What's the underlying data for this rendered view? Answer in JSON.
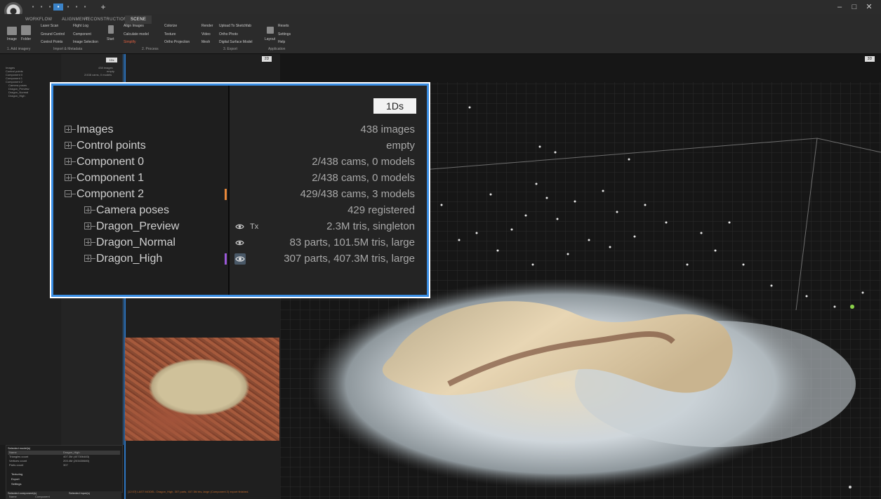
{
  "ribbon": {
    "tabs": [
      "WORKFLOW",
      "ALIGNMENT",
      "RECONSTRUCTION",
      "SCENE"
    ],
    "active_tab": "SCENE",
    "buttons": {
      "image": "Image",
      "folder": "Folder",
      "laser_scan": "Laser Scan",
      "ground_control": "Ground Control",
      "control_points": "Control Points",
      "flight_log": "Flight Log",
      "component": "Component",
      "image_selection": "Image Selection",
      "start": "Start",
      "align_images": "Align Images",
      "calculate_model": "Calculate model",
      "simplify": "Simplify",
      "colorize": "Colorize",
      "texture": "Texture",
      "ortho_projection": "Ortho Projection",
      "render": "Render",
      "video": "Video",
      "mesh": "Mesh",
      "upload_sketchfab": "Upload To Sketchfab",
      "ortho_photo": "Ortho Photo",
      "digital_surface_model": "Digital Surface Model",
      "layout": "Layout",
      "resets": "Resets",
      "settings": "Settings",
      "help": "Help"
    },
    "groups": [
      "1. Add imagery",
      "Import & Metadata",
      "2. Process",
      "3. Export",
      "Application"
    ]
  },
  "left_tree": {
    "items": [
      "Images",
      "Control points",
      "Component 0",
      "Component 1",
      "Component 2",
      "Camera poses",
      "Dragon_Preview",
      "Dragon_Normal",
      "Dragon_High"
    ],
    "button": "1Ds",
    "values": [
      "438 images",
      "empty",
      "2/438 cams, 0 models"
    ]
  },
  "callout": {
    "button": "1Ds",
    "rows": [
      {
        "label": "Images",
        "value": "438 images",
        "expanded": false
      },
      {
        "label": "Control points",
        "value": "empty",
        "expanded": false
      },
      {
        "label": "Component 0",
        "value": "2/438 cams, 0 models",
        "expanded": false
      },
      {
        "label": "Component 1",
        "value": "2/438 cams, 0 models",
        "expanded": false
      },
      {
        "label": "Component 2",
        "value": "429/438 cams, 3 models",
        "expanded": true
      },
      {
        "label": "Camera poses",
        "value": "429 registered",
        "expanded": false
      },
      {
        "label": "Dragon_Preview",
        "value": "2.3M tris, singleton",
        "expanded": false
      },
      {
        "label": "Dragon_Normal",
        "value": "83 parts, 101.5M tris, large",
        "expanded": false
      },
      {
        "label": "Dragon_High",
        "value": "307 parts, 407.3M tris, large",
        "expanded": false
      }
    ],
    "tx_label": "Tx",
    "marker_colors": {
      "component": "#e8883a",
      "selected": "#9b59d9"
    }
  },
  "viewport": {
    "toggle_left": "2D",
    "toggle_right": "3D"
  },
  "properties": {
    "header": "Selected model(s)",
    "rows": [
      {
        "name": "Name",
        "value": "Dragon_High"
      },
      {
        "name": "Triangles count",
        "value": "407.3M (407306483)"
      },
      {
        "name": "Vertices count",
        "value": "203.4M (203430680)"
      },
      {
        "name": "Parts count",
        "value": "307"
      }
    ],
    "sections": [
      "Texturing",
      "Export",
      "Settings"
    ],
    "bottom_tabs": [
      "Selected component(s)",
      "Selected input(s)"
    ],
    "bottom_row": [
      "Name",
      "Component"
    ]
  },
  "log": {
    "text": "[12:07] LAST MODEL: Dragon_High, 307 parts, 407.3M tris, large (Component 2) export finished."
  },
  "colors": {
    "accent": "#3a8ee4",
    "panel": "#1e1e1e",
    "text": "#d0d0d0"
  }
}
